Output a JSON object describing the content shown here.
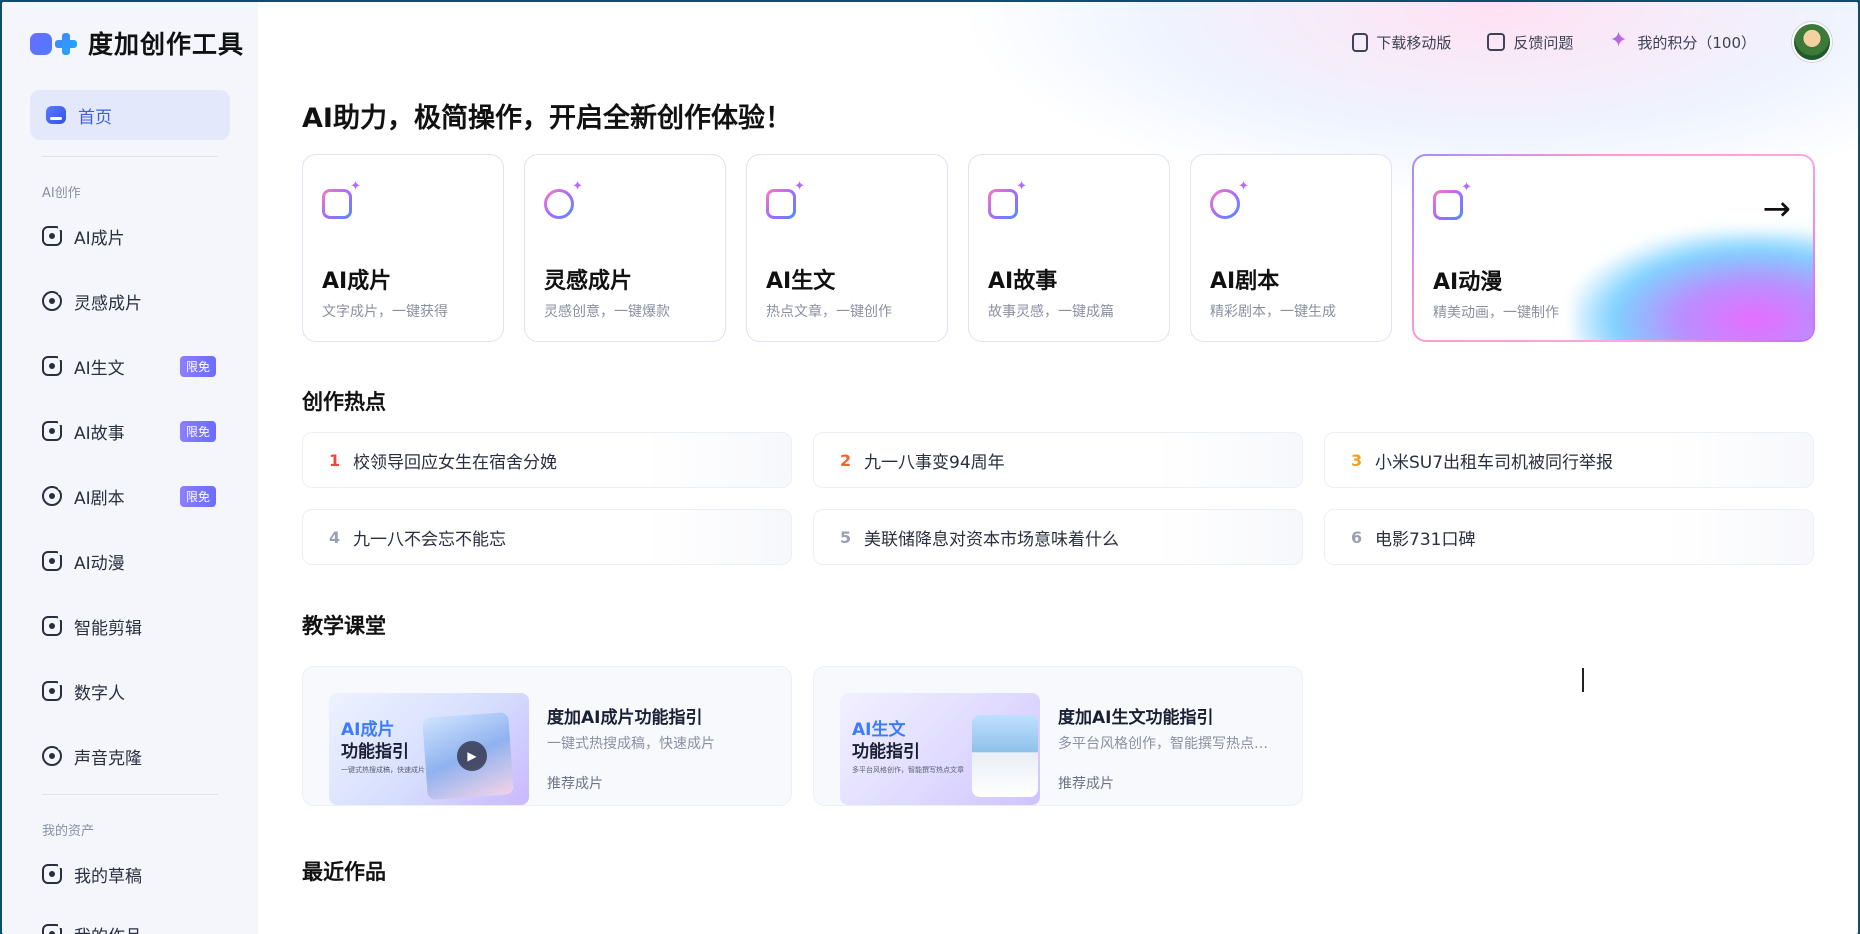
{
  "app": {
    "title": "度加创作工具"
  },
  "sidebar": {
    "home": "首页",
    "section_ai": "AI创作",
    "items": [
      {
        "label": "AI成片",
        "badge": ""
      },
      {
        "label": "灵感成片",
        "badge": ""
      },
      {
        "label": "AI生文",
        "badge": "限免"
      },
      {
        "label": "AI故事",
        "badge": "限免"
      },
      {
        "label": "AI剧本",
        "badge": "限免"
      },
      {
        "label": "AI动漫",
        "badge": ""
      },
      {
        "label": "智能剪辑",
        "badge": ""
      },
      {
        "label": "数字人",
        "badge": ""
      },
      {
        "label": "声音克隆",
        "badge": ""
      }
    ],
    "section_assets": "我的资产",
    "assets": [
      {
        "label": "我的草稿"
      },
      {
        "label": "我的作品"
      }
    ]
  },
  "topbar": {
    "download": "下载移动版",
    "feedback": "反馈问题",
    "points": "我的积分（100）"
  },
  "main": {
    "headline": "AI助力，极简操作，开启全新创作体验！",
    "cards": [
      {
        "title": "AI成片",
        "sub": "文字成片，一键获得",
        "icon": "play-icon"
      },
      {
        "title": "灵感成片",
        "sub": "灵感创意，一键爆款",
        "icon": "bulb-icon"
      },
      {
        "title": "AI生文",
        "sub": "热点文章，一键创作",
        "icon": "text-icon"
      },
      {
        "title": "AI故事",
        "sub": "故事灵感，一键成篇",
        "icon": "book-icon"
      },
      {
        "title": "AI剧本",
        "sub": "精彩剧本，一键生成",
        "icon": "palette-icon"
      },
      {
        "title": "AI动漫",
        "sub": "精美动画，一键制作",
        "icon": "smile-icon"
      }
    ],
    "hot_title": "创作热点",
    "hot": [
      {
        "rank": "1",
        "text": "校领导回应女生在宿舍分娩"
      },
      {
        "rank": "2",
        "text": "九一八事变94周年"
      },
      {
        "rank": "3",
        "text": "小米SU7出租车司机被同行举报"
      },
      {
        "rank": "4",
        "text": "九一八不会忘不能忘"
      },
      {
        "rank": "5",
        "text": "美联储降息对资本市场意味着什么"
      },
      {
        "rank": "6",
        "text": "电影731口碑"
      }
    ],
    "class_title": "教学课堂",
    "lessons": [
      {
        "thumb_t1": "AI成片",
        "thumb_t2": "功能指引",
        "thumb_t3": "一键式热搜成稿，快速成片",
        "title": "度加AI成片功能指引",
        "sub": "一键式热搜成稿，快速成片",
        "tag": "推荐成片"
      },
      {
        "thumb_t1": "AI生文",
        "thumb_t2": "功能指引",
        "thumb_t3": "多平台风格创作，智能撰写热点文章",
        "title": "度加AI生文功能指引",
        "sub": "多平台风格创作，智能撰写热点文章",
        "tag": "推荐成片"
      }
    ],
    "recent_title": "最近作品"
  }
}
